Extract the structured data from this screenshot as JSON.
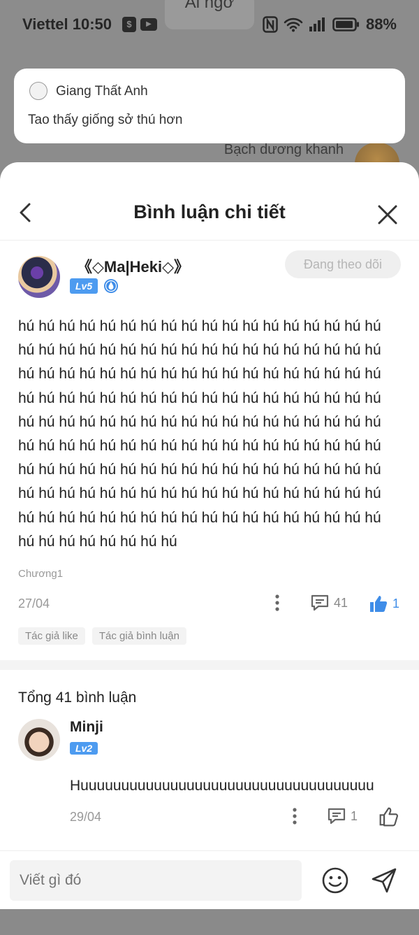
{
  "status_bar": {
    "carrier_time": "Viettel 10:50",
    "battery": "88%",
    "small_icons": [
      "shopping-bag-icon",
      "youtube-icon"
    ],
    "right_icons": [
      "nfc-icon",
      "wifi-icon",
      "signal-icon",
      "battery-icon"
    ]
  },
  "background": {
    "top_label": "Ai ngờ",
    "name": "Bạch dương khanh"
  },
  "notification": {
    "sender": "Giang Thất Anh",
    "message": "Tao thấy giống sở thú hơn"
  },
  "sheet": {
    "title": "Bình luận chi tiết",
    "post": {
      "author": "《◇Ma|Heki◇》",
      "level": "Lv5",
      "follow_label": "Đang theo dõi",
      "content": "hú hú hú hú hú hú hú hú hú hú hú hú hú hú hú hú hú hú hú hú hú hú hú hú hú hú hú hú hú hú hú hú hú hú hú hú hú hú hú hú hú hú hú hú hú hú hú hú hú hú hú hú hú hú hú hú hú hú hú hú hú hú hú hú hú hú hú hú hú hú hú hú hú hú hú hú hú hú hú hú hú hú hú hú hú hú hú hú hú hú hú hú hú hú hú hú hú hú hú hú hú hú hú hú hú hú hú hú hú hú hú hú hú hú hú hú hú hú hú hú hú hú hú hú hú hú hú hú hú hú hú hú hú hú hú hú hú hú hú hú hú hú hú hú hú hú hú hú hú hú hú hú hú hú hú hú hú hú hú hú hú hú hú hú hú hú hú hú hú hú",
      "chapter": "Chương1",
      "date": "27/04",
      "comment_count": "41",
      "like_count": "1",
      "tags": [
        "Tác giả like",
        "Tác giả bình luận"
      ]
    },
    "total_label": "Tổng 41 bình luận",
    "reply": {
      "author": "Minji",
      "level": "Lv2",
      "text": "Huuuuuuuuuuuuuuuuuuuuuuuuuuuuuuuuuuuu",
      "date": "29/04",
      "comment_count": "1"
    },
    "input_placeholder": "Viết gì đó"
  },
  "colors": {
    "accent_blue": "#3f8de8",
    "level_badge": "#4d9bf0",
    "overlay": "#8c8c8c"
  }
}
